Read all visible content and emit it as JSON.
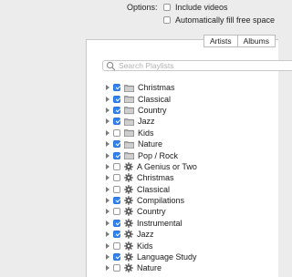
{
  "options": {
    "label": "Options:",
    "include_videos": {
      "label": "Include videos",
      "checked": false
    },
    "autofill": {
      "label": "Automatically fill free space",
      "checked": false
    }
  },
  "tabs": [
    {
      "label": "Artists"
    },
    {
      "label": "Albums"
    }
  ],
  "search": {
    "placeholder": "Search Playlists",
    "value": ""
  },
  "playlists": [
    {
      "label": "Christmas",
      "checked": true,
      "icon": "folder-icon"
    },
    {
      "label": "Classical",
      "checked": true,
      "icon": "folder-icon"
    },
    {
      "label": "Country",
      "checked": true,
      "icon": "folder-icon"
    },
    {
      "label": "Jazz",
      "checked": true,
      "icon": "folder-icon"
    },
    {
      "label": "Kids",
      "checked": false,
      "icon": "folder-icon"
    },
    {
      "label": "Nature",
      "checked": true,
      "icon": "folder-icon"
    },
    {
      "label": "Pop / Rock",
      "checked": true,
      "icon": "folder-icon"
    },
    {
      "label": "A Genius or Two",
      "checked": false,
      "icon": "gear-icon"
    },
    {
      "label": "Christmas",
      "checked": false,
      "icon": "gear-icon"
    },
    {
      "label": "Classical",
      "checked": false,
      "icon": "gear-icon"
    },
    {
      "label": "Compilations",
      "checked": true,
      "icon": "gear-icon"
    },
    {
      "label": "Country",
      "checked": false,
      "icon": "gear-icon"
    },
    {
      "label": "Instrumental",
      "checked": true,
      "icon": "gear-icon"
    },
    {
      "label": "Jazz",
      "checked": true,
      "icon": "gear-icon"
    },
    {
      "label": "Kids",
      "checked": false,
      "icon": "gear-icon"
    },
    {
      "label": "Language Study",
      "checked": true,
      "icon": "gear-icon"
    },
    {
      "label": "Nature",
      "checked": false,
      "icon": "gear-icon"
    }
  ],
  "colors": {
    "accent": "#2f83f6",
    "background": "#ececec",
    "panel": "#ffffff"
  }
}
